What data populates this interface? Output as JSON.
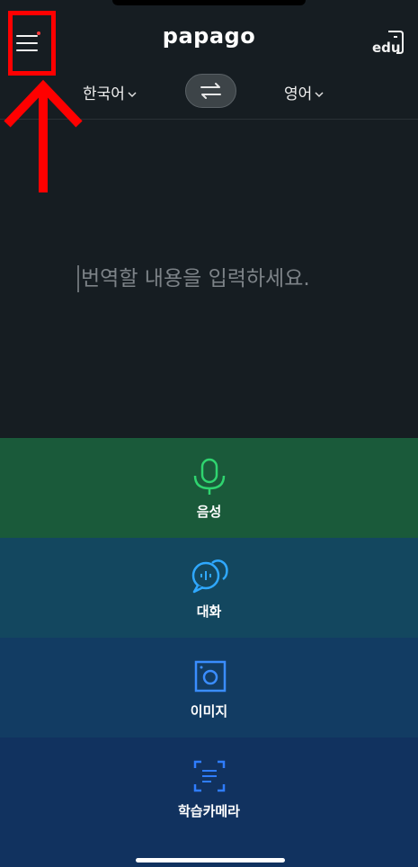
{
  "app": {
    "logo": "papago",
    "edu_label": "edu"
  },
  "header": {
    "menu_icon": "hamburger-menu-icon",
    "notification_dot_color": "#ff3b3b"
  },
  "languages": {
    "source": "한국어",
    "target": "영어",
    "swap_icon": "swap-arrows-icon"
  },
  "input": {
    "placeholder": "번역할 내용을 입력하세요."
  },
  "tools": [
    {
      "label": "음성",
      "icon": "microphone-icon",
      "color": "#2fd46f",
      "background": "#1a5a3a"
    },
    {
      "label": "대화",
      "icon": "conversation-icon",
      "color": "#2fa8ff",
      "background": "#13475f"
    },
    {
      "label": "이미지",
      "icon": "image-icon",
      "color": "#3a8dff",
      "background": "#123c63"
    },
    {
      "label": "학습카메라",
      "icon": "study-camera-icon",
      "color": "#2f7dff",
      "background": "#11325f"
    }
  ],
  "annotation": {
    "color": "#ff0000",
    "target": "hamburger-menu-icon"
  }
}
